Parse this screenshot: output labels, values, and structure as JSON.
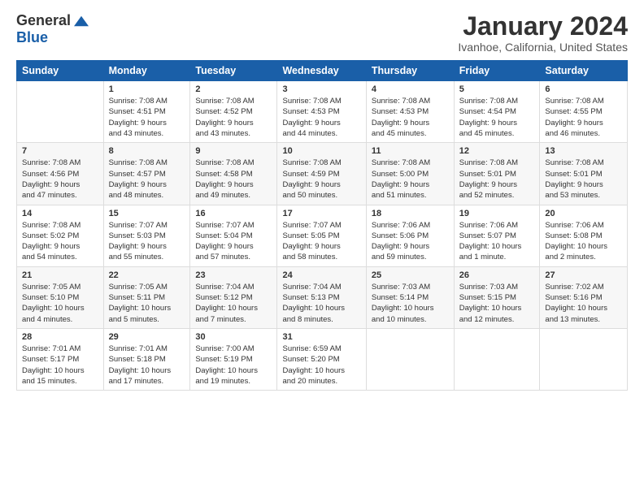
{
  "logo": {
    "general": "General",
    "blue": "Blue"
  },
  "title": "January 2024",
  "subtitle": "Ivanhoe, California, United States",
  "days_header": [
    "Sunday",
    "Monday",
    "Tuesday",
    "Wednesday",
    "Thursday",
    "Friday",
    "Saturday"
  ],
  "weeks": [
    [
      {
        "day": "",
        "info": ""
      },
      {
        "day": "1",
        "info": "Sunrise: 7:08 AM\nSunset: 4:51 PM\nDaylight: 9 hours\nand 43 minutes."
      },
      {
        "day": "2",
        "info": "Sunrise: 7:08 AM\nSunset: 4:52 PM\nDaylight: 9 hours\nand 43 minutes."
      },
      {
        "day": "3",
        "info": "Sunrise: 7:08 AM\nSunset: 4:53 PM\nDaylight: 9 hours\nand 44 minutes."
      },
      {
        "day": "4",
        "info": "Sunrise: 7:08 AM\nSunset: 4:53 PM\nDaylight: 9 hours\nand 45 minutes."
      },
      {
        "day": "5",
        "info": "Sunrise: 7:08 AM\nSunset: 4:54 PM\nDaylight: 9 hours\nand 45 minutes."
      },
      {
        "day": "6",
        "info": "Sunrise: 7:08 AM\nSunset: 4:55 PM\nDaylight: 9 hours\nand 46 minutes."
      }
    ],
    [
      {
        "day": "7",
        "info": "Sunrise: 7:08 AM\nSunset: 4:56 PM\nDaylight: 9 hours\nand 47 minutes."
      },
      {
        "day": "8",
        "info": "Sunrise: 7:08 AM\nSunset: 4:57 PM\nDaylight: 9 hours\nand 48 minutes."
      },
      {
        "day": "9",
        "info": "Sunrise: 7:08 AM\nSunset: 4:58 PM\nDaylight: 9 hours\nand 49 minutes."
      },
      {
        "day": "10",
        "info": "Sunrise: 7:08 AM\nSunset: 4:59 PM\nDaylight: 9 hours\nand 50 minutes."
      },
      {
        "day": "11",
        "info": "Sunrise: 7:08 AM\nSunset: 5:00 PM\nDaylight: 9 hours\nand 51 minutes."
      },
      {
        "day": "12",
        "info": "Sunrise: 7:08 AM\nSunset: 5:01 PM\nDaylight: 9 hours\nand 52 minutes."
      },
      {
        "day": "13",
        "info": "Sunrise: 7:08 AM\nSunset: 5:01 PM\nDaylight: 9 hours\nand 53 minutes."
      }
    ],
    [
      {
        "day": "14",
        "info": "Sunrise: 7:08 AM\nSunset: 5:02 PM\nDaylight: 9 hours\nand 54 minutes."
      },
      {
        "day": "15",
        "info": "Sunrise: 7:07 AM\nSunset: 5:03 PM\nDaylight: 9 hours\nand 55 minutes."
      },
      {
        "day": "16",
        "info": "Sunrise: 7:07 AM\nSunset: 5:04 PM\nDaylight: 9 hours\nand 57 minutes."
      },
      {
        "day": "17",
        "info": "Sunrise: 7:07 AM\nSunset: 5:05 PM\nDaylight: 9 hours\nand 58 minutes."
      },
      {
        "day": "18",
        "info": "Sunrise: 7:06 AM\nSunset: 5:06 PM\nDaylight: 9 hours\nand 59 minutes."
      },
      {
        "day": "19",
        "info": "Sunrise: 7:06 AM\nSunset: 5:07 PM\nDaylight: 10 hours\nand 1 minute."
      },
      {
        "day": "20",
        "info": "Sunrise: 7:06 AM\nSunset: 5:08 PM\nDaylight: 10 hours\nand 2 minutes."
      }
    ],
    [
      {
        "day": "21",
        "info": "Sunrise: 7:05 AM\nSunset: 5:10 PM\nDaylight: 10 hours\nand 4 minutes."
      },
      {
        "day": "22",
        "info": "Sunrise: 7:05 AM\nSunset: 5:11 PM\nDaylight: 10 hours\nand 5 minutes."
      },
      {
        "day": "23",
        "info": "Sunrise: 7:04 AM\nSunset: 5:12 PM\nDaylight: 10 hours\nand 7 minutes."
      },
      {
        "day": "24",
        "info": "Sunrise: 7:04 AM\nSunset: 5:13 PM\nDaylight: 10 hours\nand 8 minutes."
      },
      {
        "day": "25",
        "info": "Sunrise: 7:03 AM\nSunset: 5:14 PM\nDaylight: 10 hours\nand 10 minutes."
      },
      {
        "day": "26",
        "info": "Sunrise: 7:03 AM\nSunset: 5:15 PM\nDaylight: 10 hours\nand 12 minutes."
      },
      {
        "day": "27",
        "info": "Sunrise: 7:02 AM\nSunset: 5:16 PM\nDaylight: 10 hours\nand 13 minutes."
      }
    ],
    [
      {
        "day": "28",
        "info": "Sunrise: 7:01 AM\nSunset: 5:17 PM\nDaylight: 10 hours\nand 15 minutes."
      },
      {
        "day": "29",
        "info": "Sunrise: 7:01 AM\nSunset: 5:18 PM\nDaylight: 10 hours\nand 17 minutes."
      },
      {
        "day": "30",
        "info": "Sunrise: 7:00 AM\nSunset: 5:19 PM\nDaylight: 10 hours\nand 19 minutes."
      },
      {
        "day": "31",
        "info": "Sunrise: 6:59 AM\nSunset: 5:20 PM\nDaylight: 10 hours\nand 20 minutes."
      },
      {
        "day": "",
        "info": ""
      },
      {
        "day": "",
        "info": ""
      },
      {
        "day": "",
        "info": ""
      }
    ]
  ]
}
